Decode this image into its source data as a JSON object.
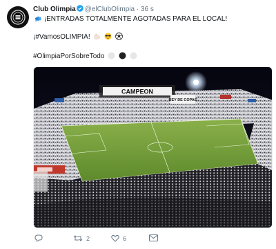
{
  "tweet": {
    "author_name": "Club Olimpia",
    "author_handle": "@elClubOlimpia",
    "separator": "·",
    "time": "36 s",
    "line1": "¡ENTRADAS TOTALMENTE AGOTADAS PARA EL LOCAL!",
    "line2": "¡#VamosOLIMPIA!",
    "line3": "#OlimpiaPorSobreTodo",
    "media_banner_text": "CAMPEON",
    "media_banner_text2": "REY DE COPAS"
  },
  "actions": {
    "reply_count": "",
    "retweet_count": "2",
    "like_count": "6",
    "dm_count": ""
  },
  "colors": {
    "accent": "#1da1f2",
    "muted": "#657786",
    "pitch": "#6f9a34",
    "night": "#0b0b1a"
  },
  "icons": [
    "crest-icon",
    "verified-icon",
    "megaphone-icon",
    "flexed-biceps-icon",
    "sunglasses-face-icon",
    "soccer-ball-icon",
    "circle-icon",
    "reply-icon",
    "retweet-icon",
    "like-icon",
    "message-icon"
  ]
}
